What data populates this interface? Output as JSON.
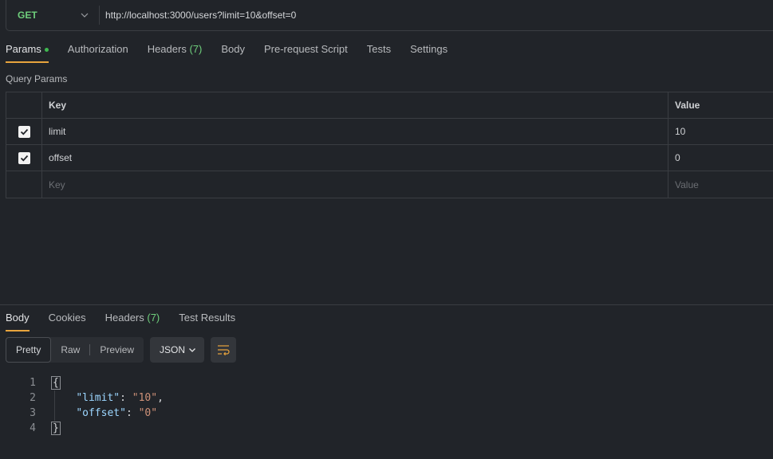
{
  "request": {
    "method": "GET",
    "url": "http://localhost:3000/users?limit=10&offset=0"
  },
  "request_tabs": [
    {
      "label": "Params",
      "active": true,
      "has_dot": true
    },
    {
      "label": "Authorization"
    },
    {
      "label": "Headers",
      "count": "(7)"
    },
    {
      "label": "Body"
    },
    {
      "label": "Pre-request Script"
    },
    {
      "label": "Tests"
    },
    {
      "label": "Settings"
    }
  ],
  "query_params": {
    "title": "Query Params",
    "headers": {
      "key": "Key",
      "value": "Value"
    },
    "rows": [
      {
        "key": "limit",
        "value": "10",
        "checked": true
      },
      {
        "key": "offset",
        "value": "0",
        "checked": true
      }
    ],
    "placeholder": {
      "key": "Key",
      "value": "Value"
    }
  },
  "response_tabs": [
    {
      "label": "Body",
      "active": true
    },
    {
      "label": "Cookies"
    },
    {
      "label": "Headers",
      "count": "(7)"
    },
    {
      "label": "Test Results"
    }
  ],
  "view_modes": [
    "Pretty",
    "Raw",
    "Preview"
  ],
  "format": "JSON",
  "code": {
    "line_numbers": [
      "1",
      "2",
      "3",
      "4"
    ],
    "open_brace": "{",
    "close_brace": "}",
    "entries": [
      {
        "key": "\"limit\"",
        "value": "\"10\"",
        "trailing": ","
      },
      {
        "key": "\"offset\"",
        "value": "\"0\"",
        "trailing": ""
      }
    ]
  },
  "colors": {
    "background": "#212429",
    "method_get": "#6fcf7c",
    "active_tab_underline": "#e8a43d",
    "json_key": "#9cd6ff",
    "json_string": "#ce9178",
    "count_green": "#6fcf7c"
  }
}
